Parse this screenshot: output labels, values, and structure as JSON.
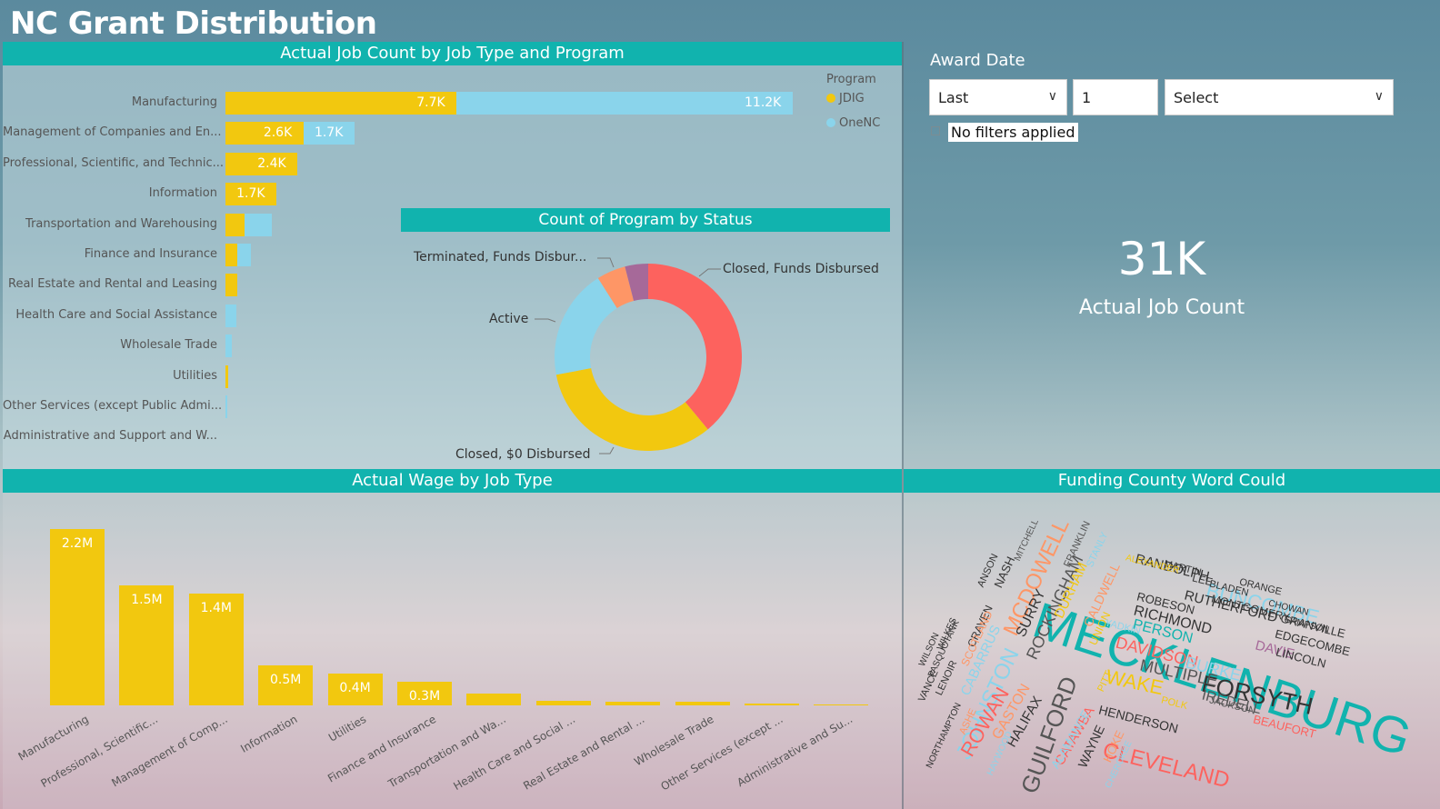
{
  "page": {
    "title": "NC Grant Distribution"
  },
  "jobs_panel": {
    "header": "Actual Job Count by Job Type and Program",
    "legend_title": "Program",
    "legend": [
      {
        "name": "JDIG",
        "color": "#f2c80f"
      },
      {
        "name": "OneNC",
        "color": "#8ad4eb"
      }
    ]
  },
  "status_panel": {
    "header": "Count of Program by Status",
    "labels": {
      "terminated": "Terminated, Funds Disbur...",
      "closed_disbursed": "Closed, Funds Disbursed",
      "active": "Active",
      "closed_zero": "Closed, $0 Disbursed"
    }
  },
  "slicer": {
    "label": "Award Date",
    "period_select": "Last",
    "count_value": "1",
    "unit_select": "Select",
    "filter_text": "No filters applied"
  },
  "kpi": {
    "value": "31K",
    "label": "Actual Job Count"
  },
  "wage_panel": {
    "header": "Actual Wage by Job Type"
  },
  "cloud_panel": {
    "header": "Funding County Word Could"
  },
  "chart_data": [
    {
      "type": "bar",
      "orientation": "horizontal",
      "stacked": true,
      "title": "Actual Job Count by Job Type and Program",
      "categories": [
        "Manufacturing",
        "Management of Companies and En...",
        "Professional, Scientific, and Technic...",
        "Information",
        "Transportation and Warehousing",
        "Finance and Insurance",
        "Real Estate and Rental and Leasing",
        "Health Care and Social Assistance",
        "Wholesale Trade",
        "Utilities",
        "Other Services (except Public Admi...",
        "Administrative and Support and W..."
      ],
      "series": [
        {
          "name": "JDIG",
          "color": "#f2c80f",
          "values": [
            7700,
            2600,
            2400,
            1700,
            650,
            400,
            400,
            0,
            0,
            100,
            0,
            0
          ],
          "labels": [
            "7.7K",
            "2.6K",
            "2.4K",
            "1.7K",
            "",
            "",
            "",
            "",
            "",
            "",
            "",
            ""
          ]
        },
        {
          "name": "OneNC",
          "color": "#8ad4eb",
          "values": [
            11200,
            1700,
            0,
            0,
            900,
            450,
            0,
            350,
            200,
            0,
            50,
            0
          ],
          "labels": [
            "11.2K",
            "1.7K",
            "",
            "",
            "",
            "",
            "",
            "",
            "",
            "",
            "",
            ""
          ]
        }
      ],
      "xlim": [
        0,
        19500
      ],
      "legend": "top-right"
    },
    {
      "type": "pie",
      "donut": true,
      "title": "Count of Program by Status",
      "slices": [
        {
          "label": "Closed, Funds Disbursed",
          "value": 39,
          "color": "#fd625e"
        },
        {
          "label": "Closed, $0 Disbursed",
          "value": 33,
          "color": "#f2c80f"
        },
        {
          "label": "Active",
          "value": 19,
          "color": "#8ad4eb"
        },
        {
          "label": "Terminated, Funds Disbur...",
          "value": 5,
          "color": "#fe9666"
        },
        {
          "label": "",
          "value": 4,
          "color": "#a66999"
        }
      ]
    },
    {
      "type": "bar",
      "orientation": "vertical",
      "title": "Actual Wage by Job Type",
      "categories": [
        "Manufacturing",
        "Professional, Scientific...",
        "Management of Comp...",
        "Information",
        "Utilities",
        "Finance and Insurance",
        "Transportation and Wa...",
        "Health Care and Social ...",
        "Real Estate and Rental ...",
        "Wholesale Trade",
        "Other Services (except ...",
        "Administrative and Su..."
      ],
      "values": [
        2200000,
        1500000,
        1400000,
        500000,
        400000,
        300000,
        150000,
        60000,
        50000,
        40000,
        20000,
        0
      ],
      "labels": [
        "2.2M",
        "1.5M",
        "1.4M",
        "0.5M",
        "0.4M",
        "0.3M",
        "",
        "",
        "",
        "",
        "",
        ""
      ],
      "color": "#f2c80f",
      "ylim": [
        0,
        2200000
      ]
    }
  ],
  "word_cloud": [
    {
      "text": "MECKLENBURG",
      "color": "#11b3ae",
      "size": 56,
      "rot": 18
    },
    {
      "text": "GUILFORD",
      "color": "#555",
      "size": 26,
      "rot": -70
    },
    {
      "text": "FORSYTH",
      "color": "#333",
      "size": 26,
      "rot": 12
    },
    {
      "text": "CLEVELAND",
      "color": "#fd625e",
      "size": 24,
      "rot": 14
    },
    {
      "text": "WAKE",
      "color": "#f2c80f",
      "size": 22,
      "rot": 12
    },
    {
      "text": "JOHNSTON",
      "color": "#8ad4eb",
      "size": 24,
      "rot": -65
    },
    {
      "text": "MCDOWELL",
      "color": "#fe9666",
      "size": 24,
      "rot": -65
    },
    {
      "text": "BUNCOMBE",
      "color": "#8ad4eb",
      "size": 22,
      "rot": 14
    },
    {
      "text": "ROWAN",
      "color": "#fd625e",
      "size": 22,
      "rot": -60
    },
    {
      "text": "ROCKINGHAM",
      "color": "#555",
      "size": 18,
      "rot": -65
    },
    {
      "text": "DAVIDSON",
      "color": "#fd625e",
      "size": 18,
      "rot": 14
    },
    {
      "text": "RICHMOND",
      "color": "#333",
      "size": 16,
      "rot": 14
    },
    {
      "text": "BURKE",
      "color": "#8ad4eb",
      "size": 18,
      "rot": 14
    },
    {
      "text": "PERSON",
      "color": "#11b3ae",
      "size": 16,
      "rot": 14
    },
    {
      "text": "MULTIPLE",
      "color": "#555",
      "size": 18,
      "rot": 12
    },
    {
      "text": "RUTHERFORD",
      "color": "#333",
      "size": 15,
      "rot": 14
    },
    {
      "text": "RANDOLPH",
      "color": "#333",
      "size": 15,
      "rot": 14
    },
    {
      "text": "ROBESON",
      "color": "#333",
      "size": 13,
      "rot": 14
    },
    {
      "text": "IREDELL",
      "color": "#555",
      "size": 16,
      "rot": 14
    },
    {
      "text": "DAVIE",
      "color": "#a66999",
      "size": 15,
      "rot": 14
    },
    {
      "text": "HENDERSON",
      "color": "#333",
      "size": 14,
      "rot": 14
    },
    {
      "text": "BEAUFORT",
      "color": "#fd625e",
      "size": 13,
      "rot": 14
    },
    {
      "text": "GRANVILLE",
      "color": "#333",
      "size": 13,
      "rot": 14
    },
    {
      "text": "EDGECOMBE",
      "color": "#333",
      "size": 13,
      "rot": 14
    },
    {
      "text": "LINCOLN",
      "color": "#333",
      "size": 13,
      "rot": 14
    },
    {
      "text": "HALIFAX",
      "color": "#333",
      "size": 15,
      "rot": -60
    },
    {
      "text": "GASTON",
      "color": "#fe9666",
      "size": 16,
      "rot": -60
    },
    {
      "text": "CATAWBA",
      "color": "#fd625e",
      "size": 15,
      "rot": -60
    },
    {
      "text": "ALAMANCE",
      "color": "#8ad4eb",
      "size": 13,
      "rot": -60
    },
    {
      "text": "WAYNE",
      "color": "#333",
      "size": 14,
      "rot": -65
    },
    {
      "text": "HOKE",
      "color": "#fe9666",
      "size": 13,
      "rot": -65
    },
    {
      "text": "SURRY",
      "color": "#333",
      "size": 16,
      "rot": -65
    },
    {
      "text": "DURHAM",
      "color": "#f2c80f",
      "size": 15,
      "rot": -65
    },
    {
      "text": "CALDWELL",
      "color": "#fe9666",
      "size": 14,
      "rot": -65
    },
    {
      "text": "CABARRUS",
      "color": "#8ad4eb",
      "size": 15,
      "rot": -65
    },
    {
      "text": "NASH",
      "color": "#333",
      "size": 13,
      "rot": -65
    },
    {
      "text": "CRAVEN",
      "color": "#333",
      "size": 12,
      "rot": -65
    },
    {
      "text": "UNION",
      "color": "#f2c80f",
      "size": 12,
      "rot": -65
    },
    {
      "text": "LENOIR",
      "color": "#333",
      "size": 11,
      "rot": -65
    },
    {
      "text": "ANSON",
      "color": "#333",
      "size": 11,
      "rot": -65
    },
    {
      "text": "SCOTLAND",
      "color": "#fe9666",
      "size": 12,
      "rot": -65
    },
    {
      "text": "VANCE",
      "color": "#333",
      "size": 11,
      "rot": -65
    },
    {
      "text": "PASQUOTANK",
      "color": "#333",
      "size": 10,
      "rot": -65
    },
    {
      "text": "NORTHAMPTON",
      "color": "#333",
      "size": 10,
      "rot": -65
    },
    {
      "text": "ASHE",
      "color": "#fe9666",
      "size": 11,
      "rot": -65
    },
    {
      "text": "WILSON",
      "color": "#333",
      "size": 10,
      "rot": -65
    },
    {
      "text": "WILKES",
      "color": "#333",
      "size": 10,
      "rot": -65
    },
    {
      "text": "FRANKLIN",
      "color": "#555",
      "size": 11,
      "rot": -65
    },
    {
      "text": "STANLY",
      "color": "#8ad4eb",
      "size": 11,
      "rot": -65
    },
    {
      "text": "MITCHELL",
      "color": "#555",
      "size": 10,
      "rot": -65
    },
    {
      "text": "PITT",
      "color": "#f2c80f",
      "size": 11,
      "rot": -65
    },
    {
      "text": "HAYWOOD",
      "color": "#8ad4eb",
      "size": 10,
      "rot": -65
    },
    {
      "text": "CHEROKEE",
      "color": "#8ad4eb",
      "size": 10,
      "rot": -65
    },
    {
      "text": "YADKIN",
      "color": "#8ad4eb",
      "size": 11,
      "rot": 14
    },
    {
      "text": "POLK",
      "color": "#f2c80f",
      "size": 11,
      "rot": 14
    },
    {
      "text": "JACKSON",
      "color": "#555",
      "size": 11,
      "rot": 14
    },
    {
      "text": "MARTIN",
      "color": "#333",
      "size": 11,
      "rot": 14
    },
    {
      "text": "LEE",
      "color": "#333",
      "size": 12,
      "rot": 14
    },
    {
      "text": "BLADEN",
      "color": "#333",
      "size": 11,
      "rot": 14
    },
    {
      "text": "ORANGE",
      "color": "#333",
      "size": 11,
      "rot": 14
    },
    {
      "text": "MONTGOMERY",
      "color": "#333",
      "size": 12,
      "rot": 14
    },
    {
      "text": "CHOWAN",
      "color": "#333",
      "size": 10,
      "rot": 14
    },
    {
      "text": "SAMPSON",
      "color": "#333",
      "size": 10,
      "rot": 14
    },
    {
      "text": "ALEXANDER",
      "color": "#f2c80f",
      "size": 10,
      "rot": 14
    }
  ]
}
